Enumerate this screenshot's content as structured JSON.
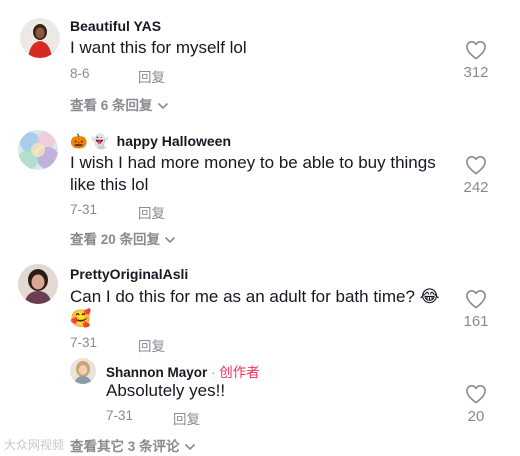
{
  "comments": [
    {
      "username": "Beautiful YAS",
      "text": "I want this for myself lol",
      "date": "8-6",
      "reply_label": "回复",
      "likes": "312",
      "view_replies": "查看 6 条回复"
    },
    {
      "username_emoji": "🎃 👻",
      "username": "happy Halloween",
      "text_line1": "I wish I had more money to be able to buy things",
      "text_line2": "like this lol",
      "date": "7-31",
      "reply_label": "回复",
      "likes": "242",
      "view_replies": "查看 20 条回复"
    },
    {
      "username": "PrettyOriginalAsli",
      "text_line1": "Can I do this for me as an adult for bath time? 😂",
      "text_line2": "🥰",
      "date": "7-31",
      "reply_label": "回复",
      "likes": "161",
      "reply": {
        "username": "Shannon Mayor",
        "separator": " · ",
        "creator_label": "创作者",
        "text": "Absolutely yes!!",
        "date": "7-31",
        "reply_label": "回复",
        "likes": "20"
      },
      "view_other": "查看其它 3 条评论"
    }
  ],
  "watermark": "大众网视频",
  "colors": {
    "text": "#161823",
    "muted": "#8a8b91",
    "creator": "#fe2c55"
  },
  "icons": {
    "like": "heart-outline-icon",
    "expand": "chevron-down-icon"
  }
}
